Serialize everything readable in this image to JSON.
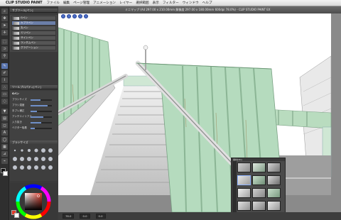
{
  "menubar": {
    "app_name": "CLIP STUDIO PAINT",
    "items": [
      "ファイル",
      "編集",
      "ページ管理",
      "アニメーション",
      "レイヤー",
      "選択範囲",
      "表示",
      "フィルター",
      "ウィンドウ",
      "ヘルプ"
    ]
  },
  "document": {
    "title": "ミニマップ (A4 297.00 x 210.00mm 解像度 297.00 x 180.00mm 600dpi 78.0%) - CLIP STUDIO PAINT EX"
  },
  "subtool_panel": {
    "header": "サブツール[ペン]",
    "items": [
      {
        "label": "Gペン"
      },
      {
        "label": "カブラペン"
      },
      {
        "label": "丸ペン"
      },
      {
        "label": "ミリペン"
      },
      {
        "label": "サインペン"
      },
      {
        "label": "ランダムペン"
      },
      {
        "label": "グラデーション"
      }
    ]
  },
  "tool_property": {
    "header": "ツールプロパティ[ペン]",
    "subheader": "Gペン",
    "rows": [
      {
        "label": "ブラシサイズ",
        "value": 0.45
      },
      {
        "label": "ブラシ濃度",
        "value": 0.8
      },
      {
        "label": "手ブレ補正",
        "value": 0.3
      },
      {
        "label": "アンチエイリアス",
        "value": 0.6
      },
      {
        "label": "入り抜き",
        "value": 0.5
      },
      {
        "label": "ベクター吸着",
        "value": 0.2
      }
    ]
  },
  "brush_panel": {
    "header": "ブラシサイズ"
  },
  "color_panel": {
    "main_color": "#e23a2a",
    "sub_color": "#ffffff"
  },
  "status": {
    "zoom": "78.0",
    "position": "0.0",
    "rotation": "0.0"
  },
  "material_panel": {
    "header": "素材[3D]"
  },
  "colors": {
    "railing_green": "#a8d8b4",
    "concrete": "#d6d6d6",
    "sky": "#ffffff"
  }
}
